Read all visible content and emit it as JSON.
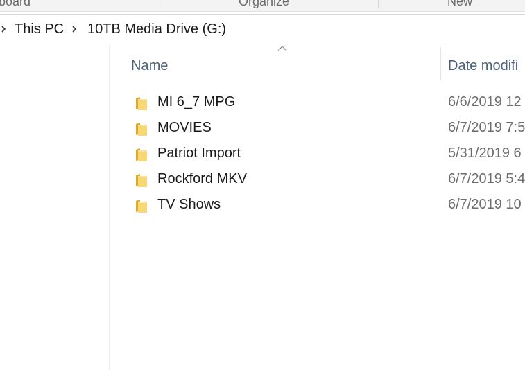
{
  "ribbon": {
    "groups": [
      "board",
      "Organize",
      "New"
    ]
  },
  "address": {
    "crumbs": [
      "This PC",
      "10TB Media Drive (G:)"
    ]
  },
  "columns": {
    "name": "Name",
    "date": "Date modifi"
  },
  "files": [
    {
      "name": "MI 6_7 MPG",
      "date": "6/6/2019 12",
      "icon": "folder-icon"
    },
    {
      "name": "MOVIES",
      "date": "6/7/2019 7:5",
      "icon": "folder-icon"
    },
    {
      "name": "Patriot Import",
      "date": "5/31/2019 6",
      "icon": "folder-icon"
    },
    {
      "name": "Rockford MKV",
      "date": "6/7/2019 5:4",
      "icon": "folder-icon"
    },
    {
      "name": "TV Shows",
      "date": "6/7/2019 10",
      "icon": "folder-icon"
    }
  ],
  "colors": {
    "header_text": "#4c607a",
    "folder_yellow": "#f8d775",
    "folder_dark": "#e0a92c"
  }
}
